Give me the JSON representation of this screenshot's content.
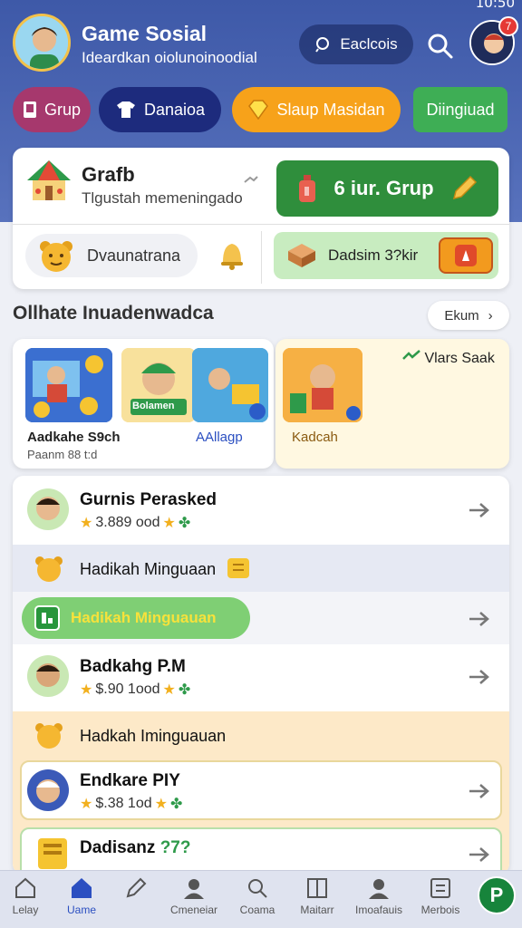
{
  "status_bar": {
    "time": "10:50"
  },
  "header": {
    "title": "Game Sosial",
    "subtitle": "Ideardkan oiolunoinoodial",
    "search_pill_label": "Eaclcois",
    "notification_count": "7"
  },
  "chips": [
    {
      "label": "Grup"
    },
    {
      "label": "Danaioa"
    },
    {
      "label": "Slaup Masidan"
    },
    {
      "label": "Diingiuad"
    }
  ],
  "quick_card": {
    "title": "Grafb",
    "subtitle": "Tlgustah memeningado",
    "join_label": "6 iur. Grup",
    "donate_label": "Dvaunatrana",
    "reward_label": "Dadsim 3?kir"
  },
  "section": {
    "title": "Ollhate Inuadenwadca",
    "all_label": "Ekum"
  },
  "games": [
    {
      "title": "Aadkahe S9ch",
      "sub": "Paanm 88 t:d",
      "inner_label": "Bolamen"
    },
    {
      "title": "AAllagp"
    },
    {
      "title": "Kadcah",
      "corner": "Vlars Saak"
    }
  ],
  "list": {
    "rows": [
      {
        "name": "Gurnis Perasked",
        "stat": "3.889 ood"
      },
      {
        "section": "Hadikah Minguaan"
      },
      {
        "highlight": "Hadikah Minguauan"
      },
      {
        "name": "Badkahg P.M",
        "stat": "$.90 1ood"
      },
      {
        "section": "Hadkah Iminguauan"
      },
      {
        "name": "Endkare PIY",
        "stat": "$.38 1od"
      },
      {
        "name": "Dadisanz",
        "stat_green": "?7?"
      }
    ]
  },
  "nav": [
    {
      "label": "Lelay"
    },
    {
      "label": "Uame"
    },
    {
      "label": ""
    },
    {
      "label": "Cmeneiar"
    },
    {
      "label": "Coama"
    },
    {
      "label": "Maitarr"
    },
    {
      "label": "Imoafauis"
    },
    {
      "label": "Merbois"
    }
  ],
  "fab_label": "P",
  "colors": {
    "header_blue": "#4a64b0",
    "accent_green": "#2f8e3c",
    "accent_orange": "#f7a21a",
    "accent_navy": "#1d2b7d",
    "accent_magenta": "#a6386d"
  }
}
